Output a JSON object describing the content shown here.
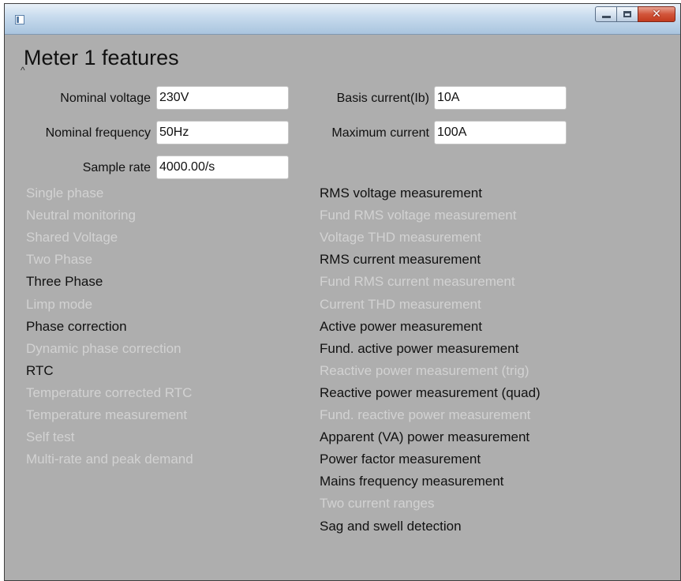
{
  "window": {
    "controls": {
      "minimize_icon": "minimize-icon",
      "maximize_icon": "maximize-icon",
      "close_icon": "close-icon"
    }
  },
  "heading": "Meter 1 features",
  "caret_glyph": "^",
  "fields": {
    "nominal_voltage": {
      "label": "Nominal voltage",
      "value": "230V"
    },
    "nominal_frequency": {
      "label": "Nominal frequency",
      "value": "50Hz"
    },
    "sample_rate": {
      "label": "Sample rate",
      "value": "4000.00/s"
    },
    "basis_current": {
      "label": "Basis current(Ib)",
      "value": "10A"
    },
    "maximum_current": {
      "label": "Maximum current",
      "value": "100A"
    }
  },
  "features_left": [
    {
      "label": "Single phase",
      "enabled": false
    },
    {
      "label": "Neutral monitoring",
      "enabled": false
    },
    {
      "label": "Shared Voltage",
      "enabled": false
    },
    {
      "label": "Two Phase",
      "enabled": false
    },
    {
      "label": "Three Phase",
      "enabled": true
    },
    {
      "label": "Limp mode",
      "enabled": false
    },
    {
      "label": "Phase correction",
      "enabled": true
    },
    {
      "label": "Dynamic phase correction",
      "enabled": false
    },
    {
      "label": "RTC",
      "enabled": true
    },
    {
      "label": "Temperature corrected RTC",
      "enabled": false
    },
    {
      "label": "Temperature measurement",
      "enabled": false
    },
    {
      "label": "Self test",
      "enabled": false
    },
    {
      "label": "Multi-rate and peak demand",
      "enabled": false
    }
  ],
  "features_right": [
    {
      "label": "RMS voltage measurement",
      "enabled": true
    },
    {
      "label": "Fund RMS voltage measurement",
      "enabled": false
    },
    {
      "label": "Voltage THD measurement",
      "enabled": false
    },
    {
      "label": "RMS current measurement",
      "enabled": true
    },
    {
      "label": "Fund RMS current measurement",
      "enabled": false
    },
    {
      "label": "Current THD measurement",
      "enabled": false
    },
    {
      "label": "Active power measurement",
      "enabled": true
    },
    {
      "label": "Fund. active power measurement",
      "enabled": true
    },
    {
      "label": "Reactive power measurement (trig)",
      "enabled": false
    },
    {
      "label": "Reactive power measurement (quad)",
      "enabled": true
    },
    {
      "label": "Fund. reactive power measurement",
      "enabled": false
    },
    {
      "label": "Apparent (VA) power measurement",
      "enabled": true
    },
    {
      "label": "Power factor measurement",
      "enabled": true
    },
    {
      "label": "Mains frequency measurement",
      "enabled": true
    },
    {
      "label": "Two current ranges",
      "enabled": false
    },
    {
      "label": "Sag and swell detection",
      "enabled": true
    }
  ],
  "colors": {
    "window_bg": "#aeaeae",
    "enabled_text": "#111111",
    "disabled_text": "#d2d2d2",
    "close_button": "#c23a1e"
  }
}
